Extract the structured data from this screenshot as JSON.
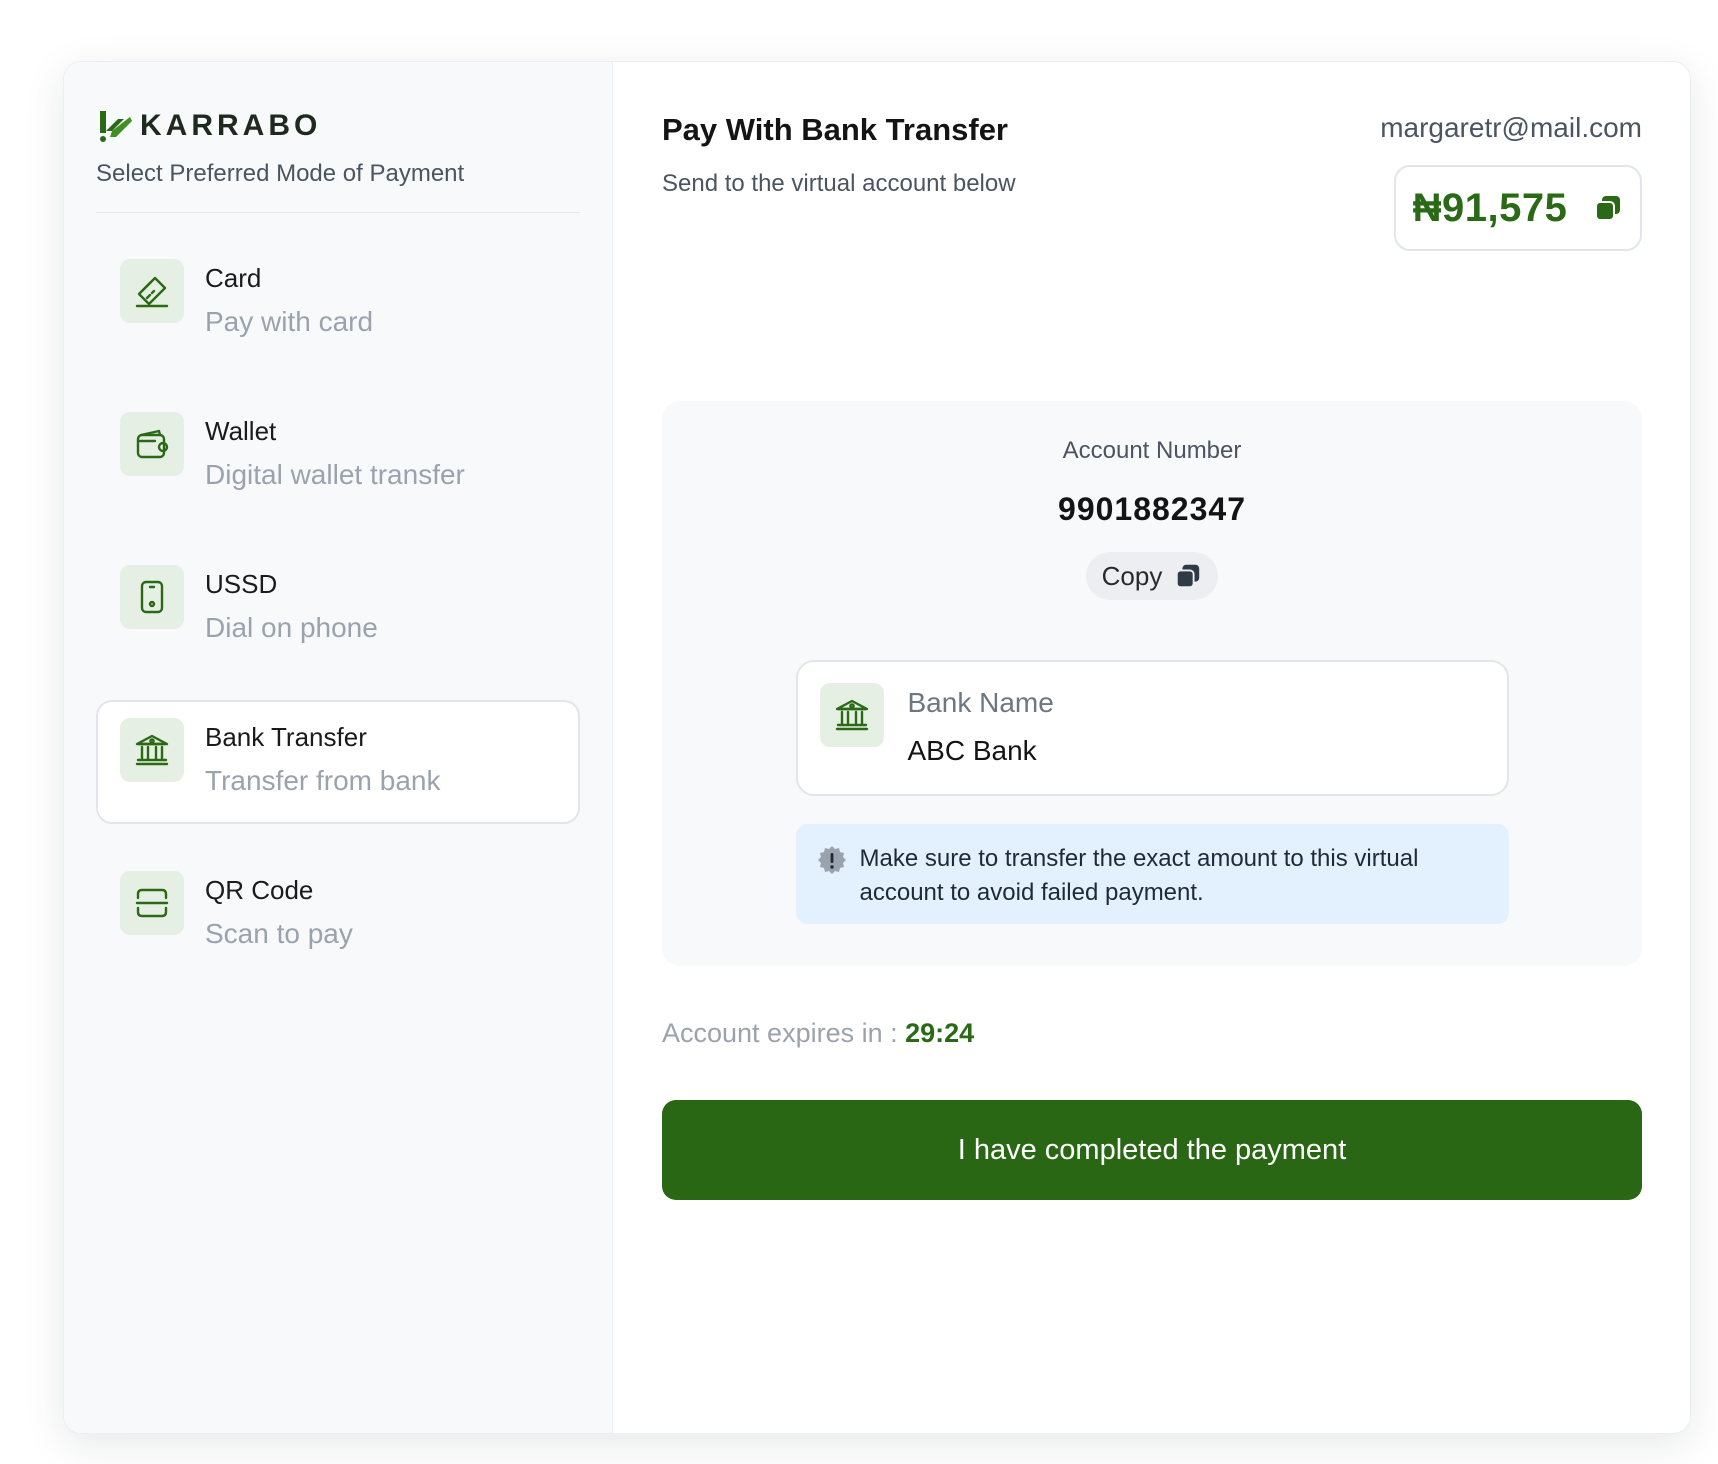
{
  "brand": {
    "name": "KARRABO",
    "color": "#2a6a16"
  },
  "sidebar": {
    "subtitle": "Select Preferred Mode of Payment",
    "options": [
      {
        "icon": "card-icon",
        "title": "Card",
        "subtitle": "Pay with card",
        "active": false
      },
      {
        "icon": "wallet-icon",
        "title": "Wallet",
        "subtitle": "Digital wallet transfer",
        "active": false
      },
      {
        "icon": "phone-icon",
        "title": "USSD",
        "subtitle": "Dial on phone",
        "active": false
      },
      {
        "icon": "bank-icon",
        "title": "Bank Transfer",
        "subtitle": "Transfer from bank",
        "active": true
      },
      {
        "icon": "qr-code-icon",
        "title": "QR Code",
        "subtitle": "Scan to pay",
        "active": false
      }
    ]
  },
  "main": {
    "title": "Pay With Bank Transfer",
    "subtitle": "Send to the virtual account below",
    "email": "margaretr@mail.com",
    "amount": "₦91,575",
    "account": {
      "label": "Account Number",
      "number": "9901882347",
      "copy_label": "Copy"
    },
    "bank": {
      "label": "Bank Name",
      "value": "ABC Bank"
    },
    "notice": "Make sure to transfer the exact amount to this virtual account to avoid failed payment.",
    "expiry": {
      "label": "Account expires in :",
      "time": "29:24"
    },
    "complete_button": "I have completed the payment"
  }
}
